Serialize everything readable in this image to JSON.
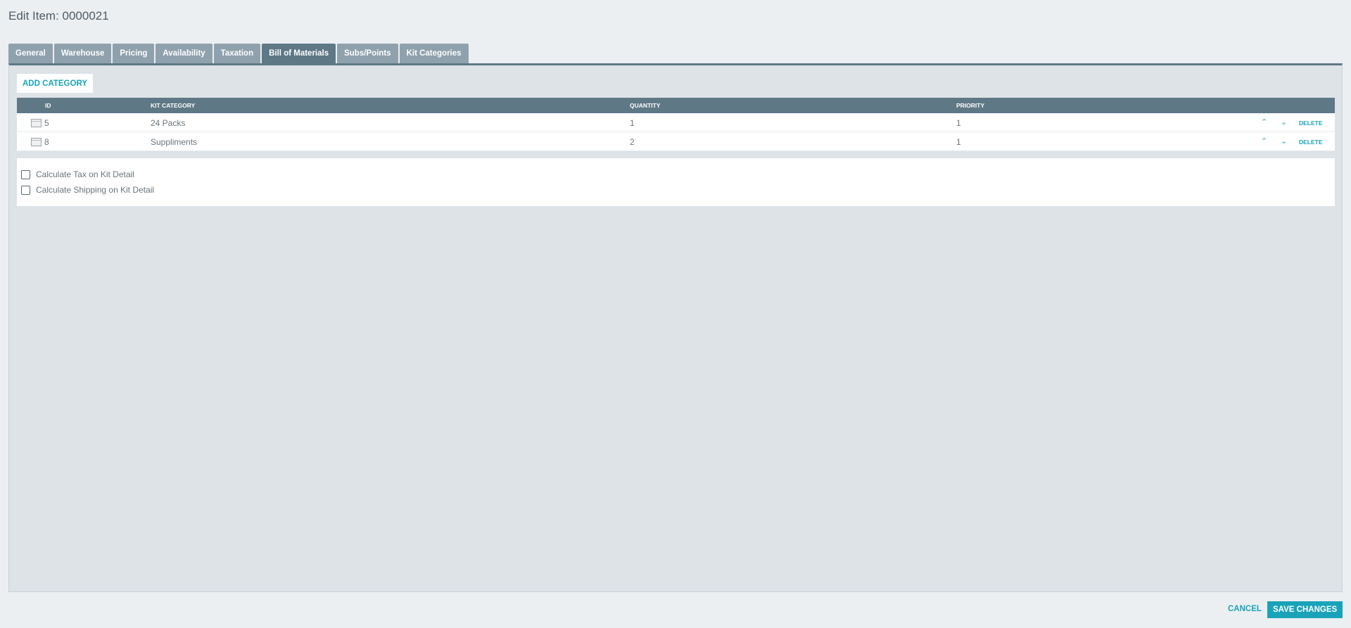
{
  "page": {
    "title": "Edit Item: 0000021"
  },
  "tabs": [
    {
      "label": "General",
      "active": false
    },
    {
      "label": "Warehouse",
      "active": false
    },
    {
      "label": "Pricing",
      "active": false
    },
    {
      "label": "Availability",
      "active": false
    },
    {
      "label": "Taxation",
      "active": false
    },
    {
      "label": "Bill of Materials",
      "active": true
    },
    {
      "label": "Subs/Points",
      "active": false
    },
    {
      "label": "Kit Categories",
      "active": false
    }
  ],
  "toolbar": {
    "add_label": "ADD CATEGORY"
  },
  "grid": {
    "columns": {
      "id": "ID",
      "kit_category": "KIT CATEGORY",
      "quantity": "QUANTITY",
      "priority": "PRIORITY"
    },
    "rows": [
      {
        "id": "5",
        "kit_category": "24 Packs",
        "quantity": "1",
        "priority": "1",
        "delete_label": "DELETE"
      },
      {
        "id": "8",
        "kit_category": "Suppliments",
        "quantity": "2",
        "priority": "1",
        "delete_label": "DELETE"
      }
    ],
    "icons": {
      "row": "item-icon",
      "up": "chevron-up-icon",
      "down": "chevron-down-icon"
    }
  },
  "options": [
    {
      "label": "Calculate Tax on Kit Detail",
      "checked": false
    },
    {
      "label": "Calculate Shipping on Kit Detail",
      "checked": false
    }
  ],
  "footer": {
    "cancel_label": "CANCEL",
    "save_label": "SAVE CHANGES"
  },
  "colors": {
    "accent": "#19a3b9",
    "header": "#5f7886",
    "tab": "#8fa1ad"
  }
}
